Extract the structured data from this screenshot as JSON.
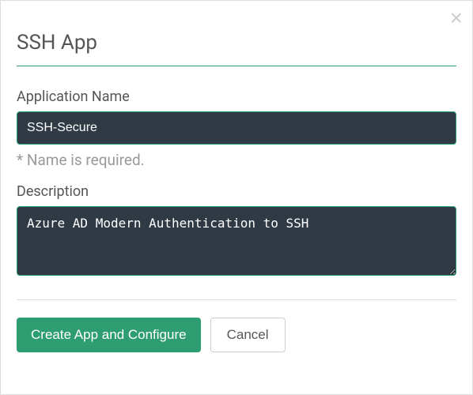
{
  "dialog": {
    "title": "SSH App",
    "fields": {
      "appName": {
        "label": "Application Name",
        "value": "SSH-Secure",
        "validation": "* Name is required."
      },
      "description": {
        "label": "Description",
        "value": "Azure AD Modern Authentication to SSH"
      }
    },
    "buttons": {
      "primary": "Create App and Configure",
      "secondary": "Cancel"
    }
  }
}
